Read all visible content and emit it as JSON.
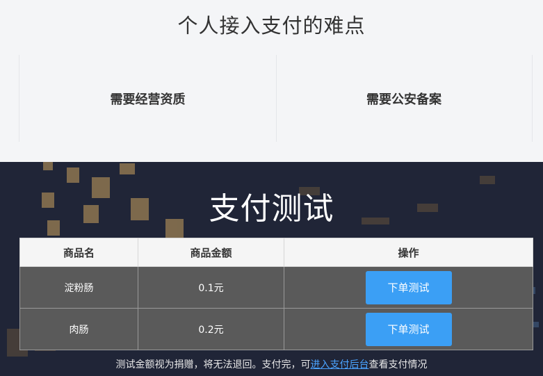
{
  "difficulties": {
    "title": "个人接入支付的难点",
    "cards": [
      "需要经营资质",
      "需要公安备案"
    ]
  },
  "payment_test": {
    "title": "支付测试",
    "headers": [
      "商品名",
      "商品金额",
      "操作"
    ],
    "rows": [
      {
        "name": "淀粉肠",
        "price": "0.1元",
        "action": "下单测试"
      },
      {
        "name": "肉肠",
        "price": "0.2元",
        "action": "下单测试"
      }
    ],
    "note_prefix": "测试金额视为捐赠，将无法退回。支付完，可",
    "note_link": "进入支付后台",
    "note_suffix": "查看支付情况"
  },
  "colors": {
    "button": "#3b9ff5",
    "link": "#4aa3ff",
    "row_bg": "#5a5a5a"
  }
}
